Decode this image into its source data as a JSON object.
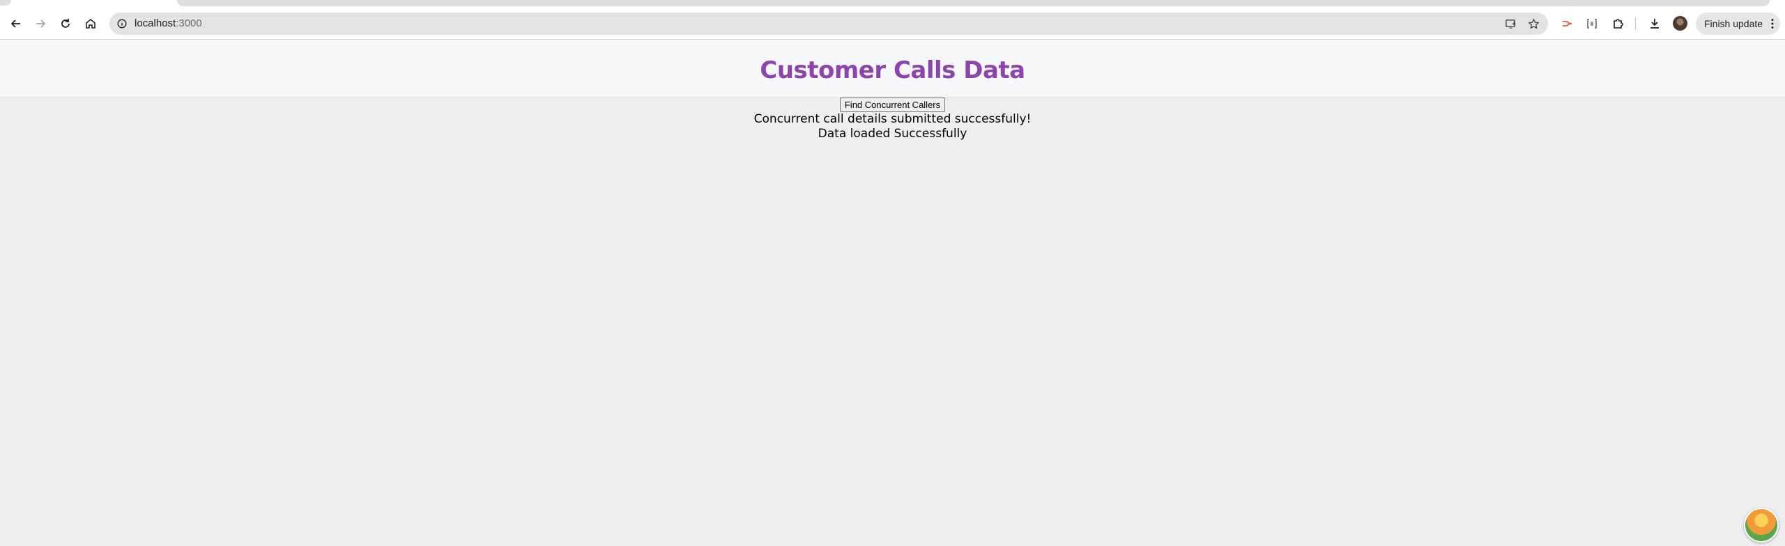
{
  "browser": {
    "url_host": "localhost",
    "url_port": ":3000",
    "finish_update_label": "Finish update",
    "icons": [
      "back-arrow-icon",
      "forward-arrow-icon",
      "reload-icon",
      "home-icon",
      "site-info-icon",
      "install-app-icon",
      "bookmark-star-icon",
      "extension-icon",
      "puzzle-icon",
      "download-icon",
      "profile-avatar",
      "menu-dots-icon"
    ]
  },
  "app": {
    "title": "Customer Calls Data",
    "find_button_label": "Find Concurrent Callers",
    "status_message": "Concurrent call details submitted successfully!",
    "load_message": "Data loaded Successfully"
  },
  "colors": {
    "title": "#8e44ad",
    "header_bg": "#f7f8fa",
    "page_bg": "#eeeeee"
  }
}
